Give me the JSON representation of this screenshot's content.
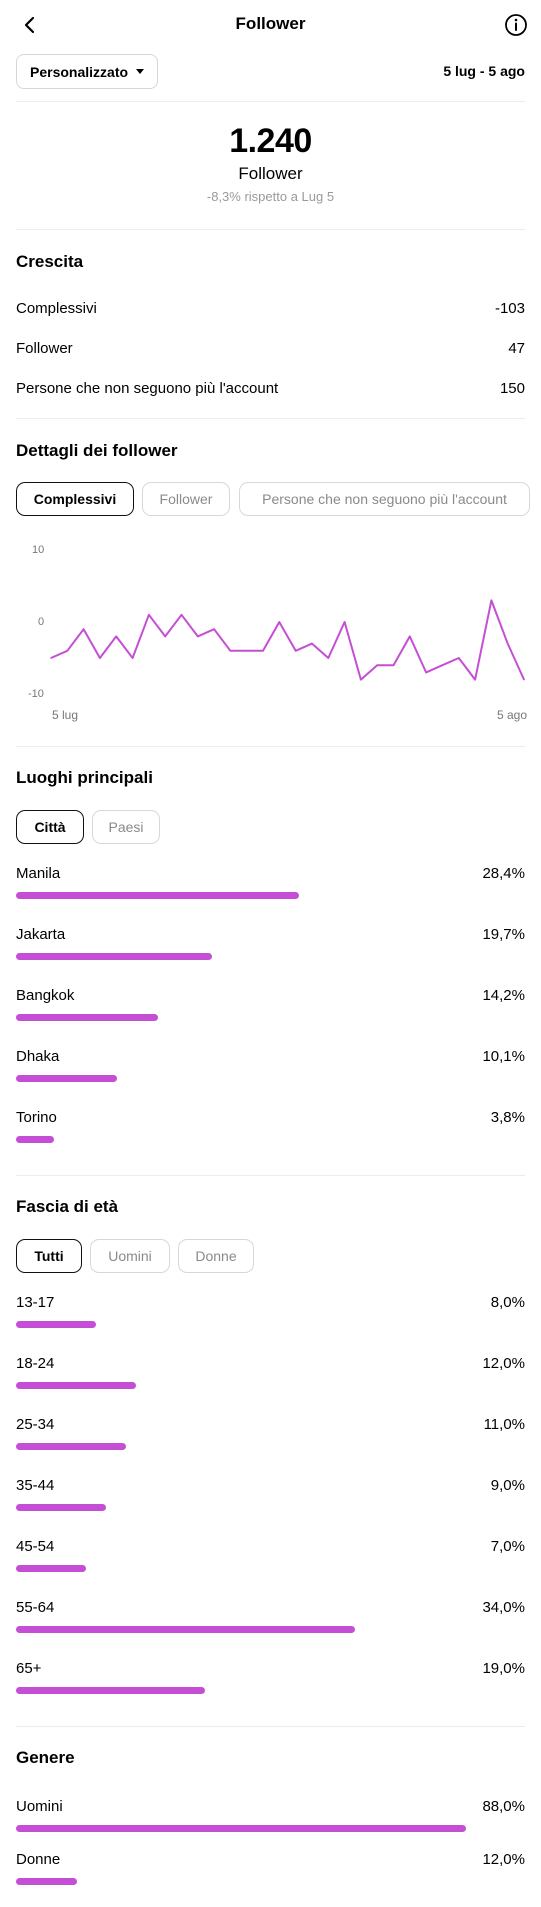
{
  "header": {
    "title": "Follower"
  },
  "range": {
    "dropdown_label": "Personalizzato",
    "dates": "5 lug - 5 ago"
  },
  "total": {
    "value": "1.240",
    "label": "Follower",
    "delta": "-8,3% rispetto a Lug 5"
  },
  "growth": {
    "title": "Crescita",
    "rows": [
      {
        "label": "Complessivi",
        "value": "-103"
      },
      {
        "label": "Follower",
        "value": "47"
      },
      {
        "label": "Persone che non seguono più l'account",
        "value": "150"
      }
    ]
  },
  "details": {
    "title": "Dettagli dei follower",
    "chips": [
      "Complessivi",
      "Follower",
      "Persone che non seguono più l'account"
    ],
    "selected_chip": "Complessivi"
  },
  "chart_data": {
    "type": "line",
    "title": "",
    "xlabel": "",
    "ylabel": "",
    "ylim": [
      -10,
      10
    ],
    "y_ticks": [
      "10",
      "0",
      "-10"
    ],
    "x_tick_labels": [
      "5 lug",
      "5 ago"
    ],
    "series": [
      {
        "values": [
          -5,
          -4,
          -1,
          -5,
          -2,
          -5,
          1,
          -2,
          1,
          -2,
          -1,
          -4,
          -4,
          -4,
          0,
          -4,
          -3,
          -5,
          0,
          -8,
          -6,
          -6,
          -2,
          -7,
          -6,
          -5,
          -8,
          3,
          -3,
          -8
        ]
      }
    ],
    "color": "#c54fd4",
    "grid": false
  },
  "locations": {
    "title": "Luoghi principali",
    "chips": [
      "Città",
      "Paesi"
    ],
    "selected_chip": "Città",
    "items": [
      {
        "label": "Manila",
        "value": "28,4%",
        "fraction": 0.284
      },
      {
        "label": "Jakarta",
        "value": "19,7%",
        "fraction": 0.197
      },
      {
        "label": "Bangkok",
        "value": "14,2%",
        "fraction": 0.142
      },
      {
        "label": "Dhaka",
        "value": "10,1%",
        "fraction": 0.101
      },
      {
        "label": "Torino",
        "value": "3,8%",
        "fraction": 0.038
      }
    ]
  },
  "age": {
    "title": "Fascia di età",
    "chips": [
      "Tutti",
      "Uomini",
      "Donne"
    ],
    "selected_chip": "Tutti",
    "items": [
      {
        "label": "13-17",
        "value": "8,0%",
        "fraction": 0.08
      },
      {
        "label": "18-24",
        "value": "12,0%",
        "fraction": 0.12
      },
      {
        "label": "25-34",
        "value": "11,0%",
        "fraction": 0.11
      },
      {
        "label": "35-44",
        "value": "9,0%",
        "fraction": 0.09
      },
      {
        "label": "45-54",
        "value": "7,0%",
        "fraction": 0.07
      },
      {
        "label": "55-64",
        "value": "34,0%",
        "fraction": 0.34
      },
      {
        "label": "65+",
        "value": "19,0%",
        "fraction": 0.19
      }
    ]
  },
  "gender": {
    "title": "Genere",
    "items": [
      {
        "label": "Uomini",
        "value": "88,0%",
        "fraction": 0.88
      },
      {
        "label": "Donne",
        "value": "12,0%",
        "fraction": 0.12
      }
    ]
  },
  "colors": {
    "accent": "#c54fd4",
    "muted": "#9a9a9a",
    "divider": "#ececec"
  }
}
